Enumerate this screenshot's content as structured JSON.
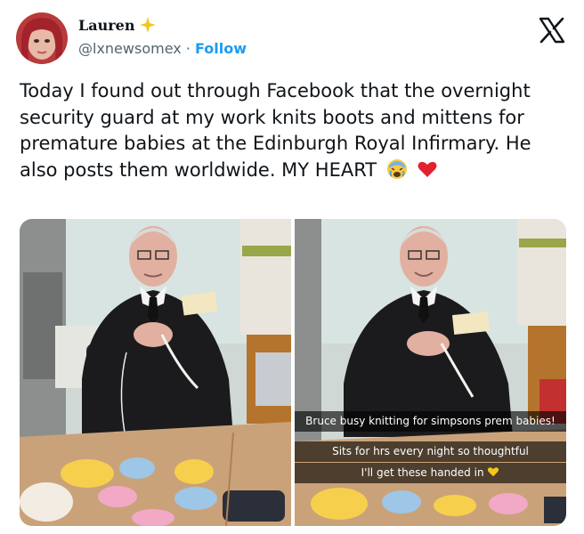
{
  "author": {
    "display_name": "Lauren",
    "handle": "@lxnewsomex",
    "separator": "·",
    "follow_label": "Follow"
  },
  "platform_icon": "x-logo-icon",
  "tweet": {
    "text": "Today I found out through Facebook that the overnight security guard at my work knits boots and mittens for premature babies at the Edinburgh Royal Infirmary. He also posts them worldwide. MY HEART"
  },
  "media": {
    "photo_captions": [
      "Bruce busy knitting for simpsons prem babies!",
      "Sits for hrs every night so thoughtful",
      "I'll get these handed in"
    ]
  },
  "colors": {
    "accent": "#1d9bf0",
    "text": "#0f1419",
    "secondary_text": "#536471"
  }
}
